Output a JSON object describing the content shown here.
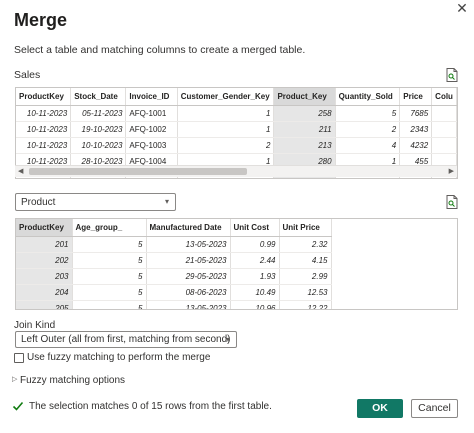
{
  "dialog": {
    "title": "Merge",
    "close_glyph": "✕",
    "subtitle": "Select a table and matching columns to create a merged table."
  },
  "sales": {
    "label": "Sales",
    "columns": [
      "ProductKey",
      "Stock_Date",
      "Invoice_ID",
      "Customer_Gender_Key",
      "Product_Key",
      "Quantity_Sold",
      "Price",
      "Colu"
    ],
    "selected_column": "Product_Key",
    "rows": [
      [
        "10-11-2023",
        "05-11-2023",
        "AFQ-1001",
        "1",
        "258",
        "5",
        "7685",
        ""
      ],
      [
        "10-11-2023",
        "19-10-2023",
        "AFQ-1002",
        "1",
        "211",
        "2",
        "2343",
        ""
      ],
      [
        "10-11-2023",
        "10-10-2023",
        "AFQ-1003",
        "2",
        "213",
        "4",
        "4232",
        ""
      ],
      [
        "10-11-2023",
        "28-10-2023",
        "AFQ-1004",
        "1",
        "280",
        "1",
        "455",
        ""
      ]
    ]
  },
  "product": {
    "selected_table": "Product",
    "columns": [
      "ProductKey",
      "Age_group_",
      "Manufactured Date",
      "Unit Cost",
      "Unit Price"
    ],
    "selected_column": "ProductKey",
    "rows": [
      [
        "201",
        "5",
        "13-05-2023",
        "0.99",
        "2.32"
      ],
      [
        "202",
        "5",
        "21-05-2023",
        "2.44",
        "4.15"
      ],
      [
        "203",
        "5",
        "29-05-2023",
        "1.93",
        "2.99"
      ],
      [
        "204",
        "5",
        "08-06-2023",
        "10.49",
        "12.53"
      ],
      [
        "205",
        "5",
        "13-05-2023",
        "10.96",
        "12.22"
      ]
    ]
  },
  "join": {
    "label": "Join Kind",
    "selected": "Left Outer (all from first, matching from second)",
    "fuzzy_checkbox_label": "Use fuzzy matching to perform the merge",
    "fuzzy_checked": false,
    "fuzzy_options_label": "Fuzzy matching options"
  },
  "status": {
    "message": "The selection matches 0 of 15 rows from the first table."
  },
  "buttons": {
    "ok": "OK",
    "cancel": "Cancel"
  },
  "colors": {
    "accent": "#117865",
    "check": "#107c10",
    "selected_column_bg": "#e6e6e6"
  },
  "icons": [
    "close-icon",
    "file-preview-icon",
    "chevron-down-icon",
    "caret-right-icon",
    "checkmark-icon",
    "scroll-left-arrow-icon",
    "scroll-right-arrow-icon"
  ]
}
